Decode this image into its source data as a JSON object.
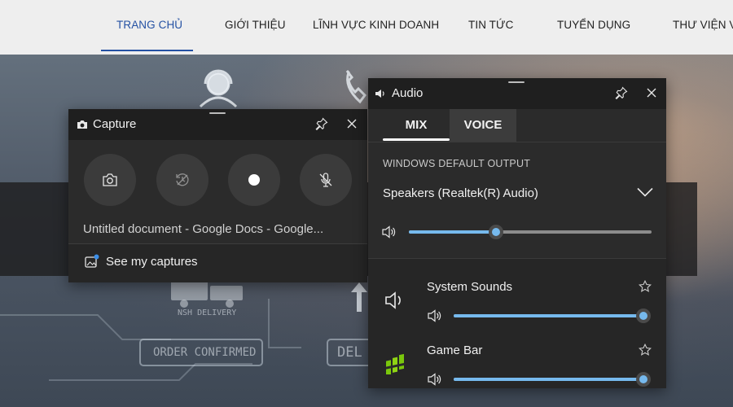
{
  "website": {
    "nav": [
      {
        "label": "TRANG CHỦ",
        "active": true
      },
      {
        "label": "GIỚI THIỆU",
        "active": false
      },
      {
        "label": "LĨNH VỰC KINH DOANH",
        "active": false
      },
      {
        "label": "TIN TỨC",
        "active": false
      },
      {
        "label": "TUYỂN DỤNG",
        "active": false
      },
      {
        "label": "THƯ VIỆN V",
        "active": false
      }
    ],
    "hero_texts": {
      "delivery": "NSH DELIVERY",
      "order": "ORDER CONFIRMED",
      "del": "DEL"
    }
  },
  "capture": {
    "title": "Capture",
    "buttons": [
      {
        "name": "screenshot",
        "icon": "camera-icon"
      },
      {
        "name": "record-last",
        "icon": "history-icon"
      },
      {
        "name": "start-recording",
        "icon": "record-dot-icon"
      },
      {
        "name": "mic-toggle",
        "icon": "mic-off-icon"
      }
    ],
    "document_title": "Untitled document - Google Docs - Google...",
    "see_captures_label": "See my captures"
  },
  "audio": {
    "title": "Audio",
    "tabs": [
      {
        "label": "MIX",
        "selected": true
      },
      {
        "label": "VOICE",
        "selected": false
      }
    ],
    "section_label": "WINDOWS DEFAULT OUTPUT",
    "output_device": "Speakers (Realtek(R) Audio)",
    "master_volume": 0.36,
    "apps": [
      {
        "name": "System Sounds",
        "volume": 1.0,
        "icon": "speaker-icon"
      },
      {
        "name": "Game Bar",
        "volume": 1.0,
        "icon": "game-bar-icon"
      }
    ]
  },
  "colors": {
    "accent": "#76b9ed",
    "widget_bg": "#2b2b2b",
    "header_bg": "#1f1f1f",
    "nav_active": "#2451a3",
    "game_bar_green": "#7ac70c"
  }
}
